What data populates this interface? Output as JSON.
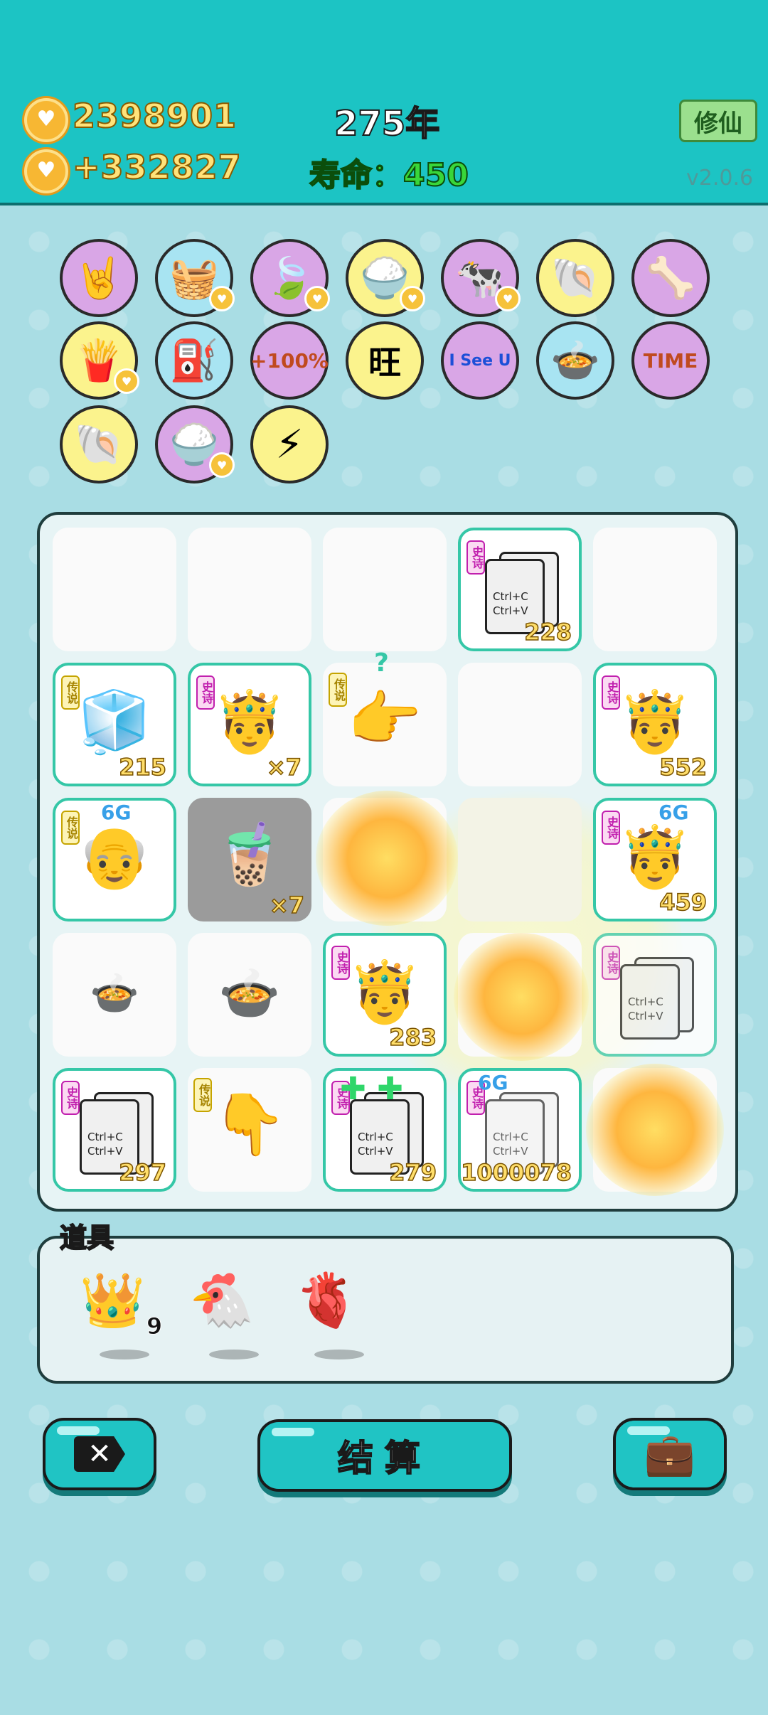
{
  "header": {
    "coins": "2398901",
    "income": "+332827",
    "year": "275年",
    "lifespan_label": "寿命：",
    "lifespan_value": "450",
    "cultivate_button": "修仙",
    "version": "v2.0.6"
  },
  "upgrades": [
    {
      "icon": "rock-hand-icon",
      "glyph": "🤘",
      "bg": "purple",
      "heart": false
    },
    {
      "icon": "fruit-basket-icon",
      "glyph": "🧺",
      "bg": "blue",
      "heart": true
    },
    {
      "icon": "leaf-icon",
      "glyph": "🍃",
      "bg": "purple",
      "heart": true
    },
    {
      "icon": "rice-bowl-icon",
      "glyph": "🍚",
      "bg": "yellow",
      "heart": true
    },
    {
      "icon": "cow-people-icon",
      "glyph": "🐄",
      "bg": "purple",
      "heart": true
    },
    {
      "icon": "shell-icon",
      "glyph": "🐚",
      "bg": "yellow",
      "heart": false
    },
    {
      "icon": "dog-bowl-icon",
      "glyph": "🦴",
      "bg": "purple",
      "heart": false
    },
    {
      "icon": "fries-icon",
      "glyph": "🍟",
      "bg": "yellow",
      "heart": true
    },
    {
      "icon": "pump-icon",
      "glyph": "⛽",
      "bg": "blue",
      "heart": false
    },
    {
      "icon": "bubble-tea-icon",
      "glyph": "🧋",
      "bg": "purple",
      "heart": false,
      "label": "+100%"
    },
    {
      "icon": "wang-tiles-icon",
      "glyph": "旺",
      "bg": "yellow",
      "heart": false
    },
    {
      "icon": "i-see-u-icon",
      "glyph": "",
      "bg": "purple",
      "heart": false,
      "label": "I See U"
    },
    {
      "icon": "pressure-cooker-icon",
      "glyph": "🍲",
      "bg": "blue",
      "heart": false
    },
    {
      "icon": "time-magazine-icon",
      "glyph": "",
      "bg": "purple",
      "heart": false,
      "label": "TIME"
    },
    {
      "icon": "shell-icon",
      "glyph": "🐚",
      "bg": "yellow",
      "heart": false
    },
    {
      "icon": "rice-bowl-icon",
      "glyph": "🍚",
      "bg": "purple",
      "heart": true
    },
    {
      "icon": "lightning-icon",
      "glyph": "⚡",
      "bg": "yellow",
      "heart": false
    }
  ],
  "board": {
    "tag_epic": "史诗",
    "tag_legend": "传说",
    "copy_text_1": "Ctrl+C",
    "copy_text_2": "Ctrl+V",
    "badge_6g": "6G",
    "question": "?",
    "values": {
      "r0c3": "228",
      "r1c0": "215",
      "r1c1": "×7",
      "r1c4": "552",
      "r2c1": "×7",
      "r2c4": "459",
      "r3c2": "283",
      "r4c0": "297",
      "r4c2": "279",
      "r4c3": "1000078"
    }
  },
  "props": {
    "title": "道具",
    "items": [
      {
        "icon": "crown-icon",
        "glyph": "👑",
        "count": "9"
      },
      {
        "icon": "chicken-icon",
        "glyph": "🐔",
        "count": ""
      },
      {
        "icon": "liver-icon",
        "glyph": "🫀",
        "count": ""
      }
    ]
  },
  "buttons": {
    "settle": "结算"
  }
}
